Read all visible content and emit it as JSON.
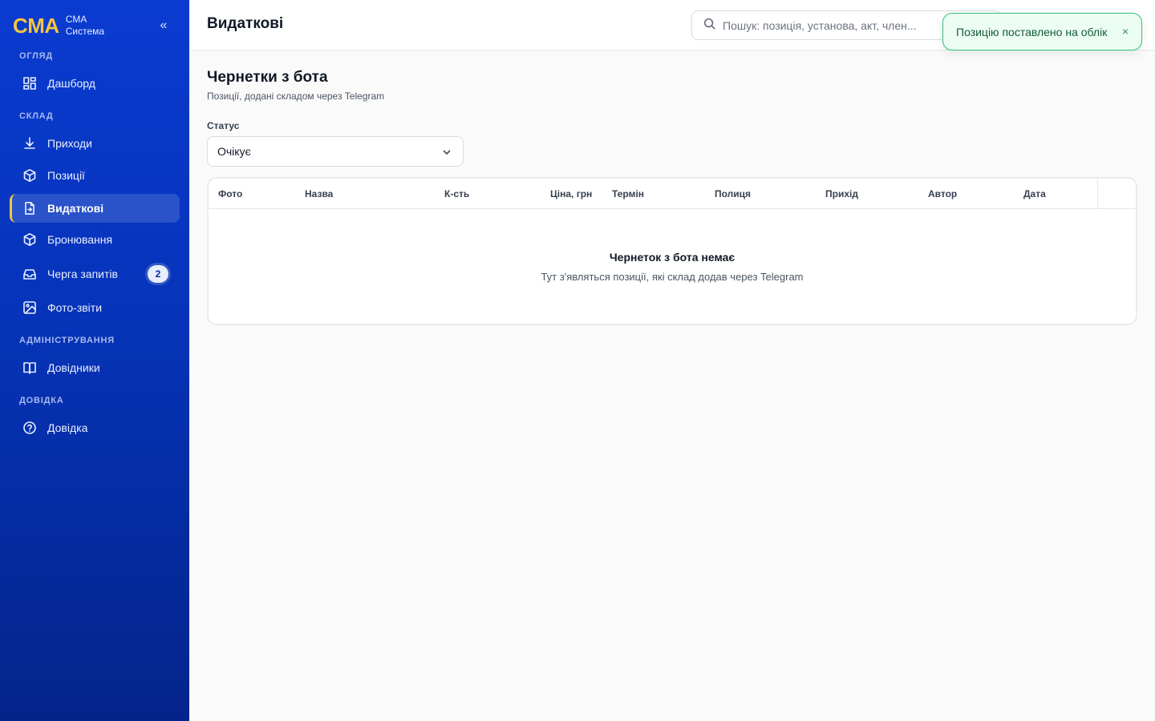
{
  "brand": {
    "logo": "CMA",
    "line1": "CMA",
    "line2": "Система",
    "collapse": "«"
  },
  "sidebar": {
    "sections": [
      {
        "label": "ОГЛЯД"
      },
      {
        "label": "СКЛАД"
      },
      {
        "label": "АДМІНІСТРУВАННЯ"
      },
      {
        "label": "ДОВІДКА"
      }
    ],
    "items": [
      {
        "label": "Дашборд",
        "icon": "dashboard-icon"
      },
      {
        "label": "Приходи",
        "icon": "download-icon"
      },
      {
        "label": "Позиції",
        "icon": "box-icon"
      },
      {
        "label": "Видаткові",
        "icon": "file-export-icon",
        "active": true
      },
      {
        "label": "Бронювання",
        "icon": "box-icon"
      },
      {
        "label": "Черга запитів",
        "icon": "inbox-icon",
        "badge": "2"
      },
      {
        "label": "Фото-звіти",
        "icon": "image-icon"
      },
      {
        "label": "Довідники",
        "icon": "book-icon"
      },
      {
        "label": "Довідка",
        "icon": "help-circle-icon"
      }
    ]
  },
  "header": {
    "title": "Видаткові",
    "search_placeholder": "Пошук: позиція, установа, акт, член..."
  },
  "toast": {
    "message": "Позицію поставлено на облік",
    "close": "×"
  },
  "main": {
    "title": "Чернетки з бота",
    "subtitle": "Позиції, додані складом через Telegram",
    "filter_label": "Статус",
    "filter_value": "Очікує",
    "columns": [
      "Фото",
      "Назва",
      "К-сть",
      "Ціна, грн",
      "Термін",
      "Полиця",
      "Прихід",
      "Автор",
      "Дата"
    ],
    "empty_title": "Чернеток з бота немає",
    "empty_subtitle": "Тут з'являться позиції, які склад додав через Telegram"
  },
  "colors": {
    "sidebar": "#0a3bd0",
    "accent": "#f5c542",
    "toast_border": "#34c07a"
  }
}
